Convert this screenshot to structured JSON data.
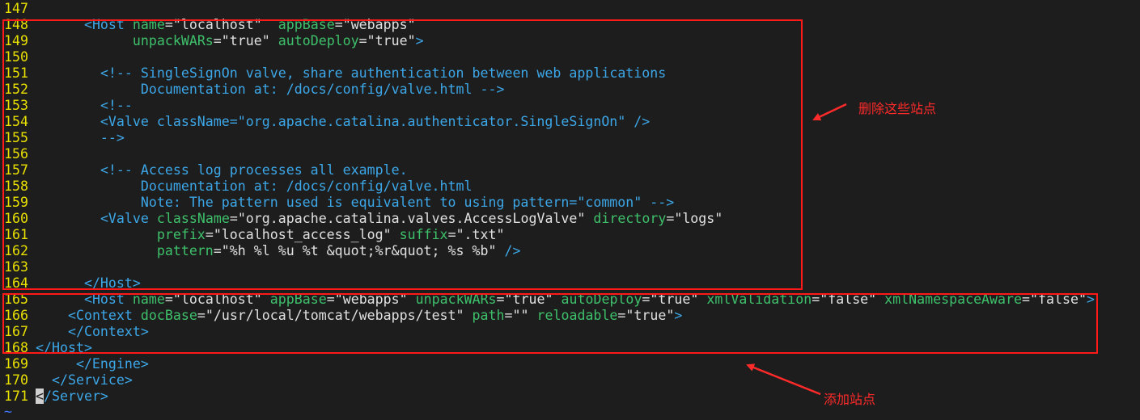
{
  "annotations": {
    "delete_label": "删除这些站点",
    "add_label": "添加站点",
    "color": "#ff2a2a"
  },
  "colors": {
    "background": "#1d1d1d",
    "line_number": "#e8e000",
    "tag": "#3ca7e8",
    "attribute": "#3ec06a",
    "value": "#e0e0e0"
  },
  "lines": [
    {
      "n": "147",
      "tokens": []
    },
    {
      "n": "148",
      "tokens": [
        [
          "p",
          "      "
        ],
        [
          "t",
          "<Host"
        ],
        [
          "p",
          " "
        ],
        [
          "a",
          "name"
        ],
        [
          "e",
          "="
        ],
        [
          "s",
          "\"localhost\""
        ],
        [
          "p",
          "  "
        ],
        [
          "a",
          "appBase"
        ],
        [
          "e",
          "="
        ],
        [
          "s",
          "\"webapps\""
        ]
      ]
    },
    {
      "n": "149",
      "tokens": [
        [
          "p",
          "            "
        ],
        [
          "a",
          "unpackWARs"
        ],
        [
          "e",
          "="
        ],
        [
          "s",
          "\"true\""
        ],
        [
          "p",
          " "
        ],
        [
          "a",
          "autoDeploy"
        ],
        [
          "e",
          "="
        ],
        [
          "s",
          "\"true\""
        ],
        [
          "t",
          ">"
        ]
      ]
    },
    {
      "n": "150",
      "tokens": []
    },
    {
      "n": "151",
      "tokens": [
        [
          "p",
          "        "
        ],
        [
          "c",
          "<!-- SingleSignOn valve, share authentication between web applications"
        ]
      ]
    },
    {
      "n": "152",
      "tokens": [
        [
          "c",
          "             Documentation at: /docs/config/valve.html -->"
        ]
      ]
    },
    {
      "n": "153",
      "tokens": [
        [
          "p",
          "        "
        ],
        [
          "c",
          "<!--"
        ]
      ]
    },
    {
      "n": "154",
      "tokens": [
        [
          "c",
          "        <Valve className=\"org.apache.catalina.authenticator.SingleSignOn\" />"
        ]
      ]
    },
    {
      "n": "155",
      "tokens": [
        [
          "c",
          "        -->"
        ]
      ]
    },
    {
      "n": "156",
      "tokens": []
    },
    {
      "n": "157",
      "tokens": [
        [
          "p",
          "        "
        ],
        [
          "c",
          "<!-- Access log processes all example."
        ]
      ]
    },
    {
      "n": "158",
      "tokens": [
        [
          "c",
          "             Documentation at: /docs/config/valve.html"
        ]
      ]
    },
    {
      "n": "159",
      "tokens": [
        [
          "c",
          "             Note: The pattern used is equivalent to using pattern=\"common\" -->"
        ]
      ]
    },
    {
      "n": "160",
      "tokens": [
        [
          "p",
          "        "
        ],
        [
          "t",
          "<Valve"
        ],
        [
          "p",
          " "
        ],
        [
          "a",
          "className"
        ],
        [
          "e",
          "="
        ],
        [
          "s",
          "\"org.apache.catalina.valves.AccessLogValve\""
        ],
        [
          "p",
          " "
        ],
        [
          "a",
          "directory"
        ],
        [
          "e",
          "="
        ],
        [
          "s",
          "\"logs\""
        ]
      ]
    },
    {
      "n": "161",
      "tokens": [
        [
          "p",
          "               "
        ],
        [
          "a",
          "prefix"
        ],
        [
          "e",
          "="
        ],
        [
          "s",
          "\"localhost_access_log\""
        ],
        [
          "p",
          " "
        ],
        [
          "a",
          "suffix"
        ],
        [
          "e",
          "="
        ],
        [
          "s",
          "\".txt\""
        ]
      ]
    },
    {
      "n": "162",
      "tokens": [
        [
          "p",
          "               "
        ],
        [
          "a",
          "pattern"
        ],
        [
          "e",
          "="
        ],
        [
          "s",
          "\"%h %l %u %t &quot;%r&quot; %s %b\""
        ],
        [
          "p",
          " "
        ],
        [
          "t",
          "/>"
        ]
      ]
    },
    {
      "n": "163",
      "tokens": []
    },
    {
      "n": "164",
      "tokens": [
        [
          "p",
          "      "
        ],
        [
          "t",
          "</Host>"
        ]
      ]
    },
    {
      "n": "165",
      "tokens": [
        [
          "p",
          "      "
        ],
        [
          "t",
          "<Host"
        ],
        [
          "p",
          " "
        ],
        [
          "a",
          "name"
        ],
        [
          "e",
          "="
        ],
        [
          "s",
          "\"localhost\""
        ],
        [
          "p",
          " "
        ],
        [
          "a",
          "appBase"
        ],
        [
          "e",
          "="
        ],
        [
          "s",
          "\"webapps\""
        ],
        [
          "p",
          " "
        ],
        [
          "a",
          "unpackWARs"
        ],
        [
          "e",
          "="
        ],
        [
          "s",
          "\"true\""
        ],
        [
          "p",
          " "
        ],
        [
          "a",
          "autoDeploy"
        ],
        [
          "e",
          "="
        ],
        [
          "s",
          "\"true\""
        ],
        [
          "p",
          " "
        ],
        [
          "a",
          "xmlValidation"
        ],
        [
          "e",
          "="
        ],
        [
          "s",
          "\"false\""
        ],
        [
          "p",
          " "
        ],
        [
          "a",
          "xmlNamespaceAware"
        ],
        [
          "e",
          "="
        ],
        [
          "s",
          "\"false\""
        ],
        [
          "t",
          ">"
        ]
      ]
    },
    {
      "n": "166",
      "tokens": [
        [
          "p",
          "    "
        ],
        [
          "t",
          "<Context"
        ],
        [
          "p",
          " "
        ],
        [
          "a",
          "docBase"
        ],
        [
          "e",
          "="
        ],
        [
          "s",
          "\"/usr/local/tomcat/webapps/test\""
        ],
        [
          "p",
          " "
        ],
        [
          "a",
          "path"
        ],
        [
          "e",
          "="
        ],
        [
          "s",
          "\"\""
        ],
        [
          "p",
          " "
        ],
        [
          "a",
          "reloadable"
        ],
        [
          "e",
          "="
        ],
        [
          "s",
          "\"true\""
        ],
        [
          "t",
          ">"
        ]
      ]
    },
    {
      "n": "167",
      "tokens": [
        [
          "p",
          "    "
        ],
        [
          "t",
          "</Context>"
        ]
      ]
    },
    {
      "n": "168",
      "tokens": [
        [
          "t",
          "</Host>"
        ]
      ]
    },
    {
      "n": "169",
      "tokens": [
        [
          "p",
          "     "
        ],
        [
          "t",
          "</Engine>"
        ]
      ]
    },
    {
      "n": "170",
      "tokens": [
        [
          "p",
          "  "
        ],
        [
          "t",
          "</Service>"
        ]
      ]
    },
    {
      "n": "171",
      "tokens": [
        [
          "k",
          "<"
        ],
        [
          "t",
          "/Server>"
        ]
      ]
    }
  ],
  "tilde": "~"
}
